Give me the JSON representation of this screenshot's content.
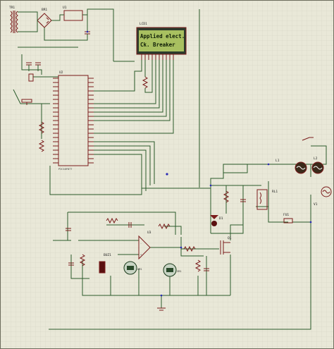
{
  "lcd": {
    "label": "LCD1",
    "line1": "Applied elect.",
    "line2": "Ck. Breaker"
  },
  "components": {
    "transformer": "TR1",
    "bridge": "BR1",
    "regulator": "U1",
    "mcu": "U2",
    "mcu_part": "PIC16F877",
    "relay": "RL1",
    "lamp": "L1",
    "lamp2": "L2",
    "source": "V1",
    "opamp": "U3",
    "mosfet": "Q1",
    "diode": "D1",
    "buzzer": "BUZ1",
    "ammeter": "AM1",
    "voltmeter": "VM1",
    "fuse": "FU1"
  },
  "colors": {
    "background": "#e9e8d8",
    "grid": "#d2d1bf",
    "wire": "#2a5a2a",
    "component": "#7a1c1c",
    "lcd_screen": "#a8c060",
    "node": "#2828b4",
    "meter": "#c8d4c4"
  }
}
